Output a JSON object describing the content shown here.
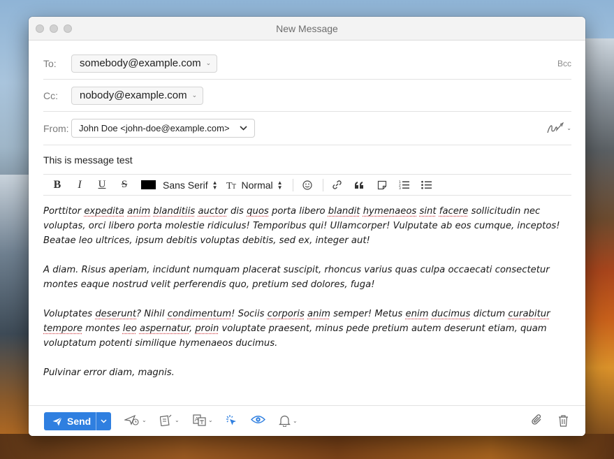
{
  "window": {
    "title": "New Message"
  },
  "to": {
    "label": "To:",
    "value": "somebody@example.com",
    "bcc": "Bcc"
  },
  "cc": {
    "label": "Cc:",
    "value": "nobody@example.com"
  },
  "from": {
    "label": "From:",
    "value": "John Doe <john-doe@example.com>"
  },
  "subject": "This is message test",
  "toolbar": {
    "bold": "B",
    "italic": "I",
    "underline": "U",
    "strike": "S",
    "text_color": "#000000",
    "font": "Sans Serif",
    "size": "Normal"
  },
  "body": {
    "p1": [
      {
        "t": "Porttitor ",
        "s": false
      },
      {
        "t": "expedita",
        "s": true
      },
      {
        "t": " ",
        "s": false
      },
      {
        "t": "anim",
        "s": true
      },
      {
        "t": " ",
        "s": false
      },
      {
        "t": "blanditiis",
        "s": true
      },
      {
        "t": " ",
        "s": false
      },
      {
        "t": "auctor",
        "s": true
      },
      {
        "t": " dis ",
        "s": false
      },
      {
        "t": "quos",
        "s": true
      },
      {
        "t": " porta libero ",
        "s": false
      },
      {
        "t": "blandit",
        "s": true
      },
      {
        "t": " ",
        "s": false
      },
      {
        "t": "hymenaeos",
        "s": true
      },
      {
        "t": " ",
        "s": false
      },
      {
        "t": "sint",
        "s": true
      },
      {
        "t": " ",
        "s": false
      },
      {
        "t": "facere",
        "s": true
      },
      {
        "t": " sollicitudin nec voluptas, orci libero porta molestie ridiculus! Temporibus qui! Ullamcorper! Vulputate ab eos cumque, inceptos! Beatae leo ultrices, ipsum debitis voluptas debitis, sed ex, integer aut!",
        "s": false
      }
    ],
    "p2": [
      {
        "t": "A diam. Risus aperiam, incidunt numquam placerat suscipit, rhoncus varius quas culpa occaecati consectetur montes eaque nostrud velit perferendis quo, pretium sed dolores, fuga!",
        "s": false
      }
    ],
    "p3": [
      {
        "t": "Voluptates ",
        "s": false
      },
      {
        "t": "deserunt",
        "s": true
      },
      {
        "t": "? Nihil ",
        "s": false
      },
      {
        "t": "condimentum",
        "s": true
      },
      {
        "t": "! Sociis ",
        "s": false
      },
      {
        "t": "corporis",
        "s": true
      },
      {
        "t": " ",
        "s": false
      },
      {
        "t": "anim",
        "s": true
      },
      {
        "t": " semper! Metus ",
        "s": false
      },
      {
        "t": "enim",
        "s": true
      },
      {
        "t": " ",
        "s": false
      },
      {
        "t": "ducimus",
        "s": true
      },
      {
        "t": " dictum ",
        "s": false
      },
      {
        "t": "curabitur",
        "s": true
      },
      {
        "t": " ",
        "s": false
      },
      {
        "t": "tempore",
        "s": true
      },
      {
        "t": " montes ",
        "s": false
      },
      {
        "t": "leo",
        "s": true
      },
      {
        "t": " ",
        "s": false
      },
      {
        "t": "aspernatur",
        "s": true
      },
      {
        "t": ", ",
        "s": false
      },
      {
        "t": "proin",
        "s": true
      },
      {
        "t": " voluptate praesent, minus pede pretium autem deserunt etiam, quam voluptatum potenti similique hymenaeos ducimus.",
        "s": false
      }
    ],
    "p4": [
      {
        "t": "Pulvinar error diam, magnis.",
        "s": false
      }
    ]
  },
  "footer": {
    "send_label": "Send"
  },
  "colors": {
    "accent": "#2f7fe0",
    "spell": "#d0454c"
  }
}
